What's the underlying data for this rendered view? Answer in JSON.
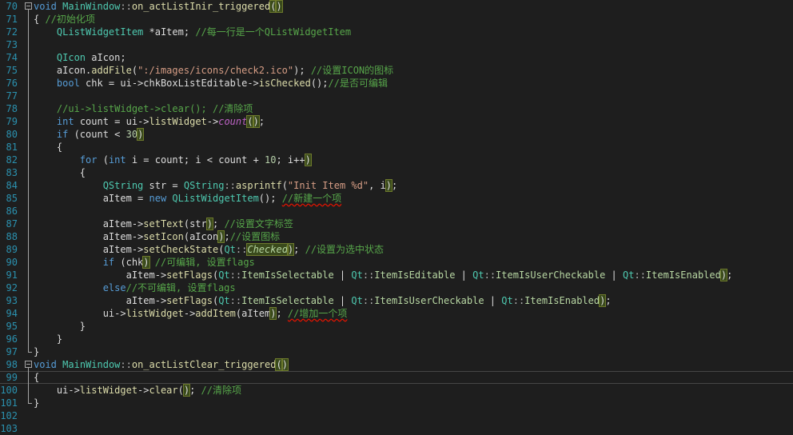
{
  "editor": {
    "lines": [
      {
        "n": "70",
        "fold": true,
        "segs": [
          [
            "kw",
            "void"
          ],
          [
            "pl",
            " "
          ],
          [
            "ty",
            "MainWindow"
          ],
          [
            "op",
            "::"
          ],
          [
            "fn",
            "on_actListInir_triggered"
          ],
          [
            "pm",
            "("
          ],
          [
            "pm",
            ")"
          ]
        ]
      },
      {
        "n": "71",
        "segs": [
          [
            "pl",
            "{ "
          ],
          [
            "cm",
            "//初始化项"
          ]
        ]
      },
      {
        "n": "72",
        "segs": [
          [
            "pl",
            "    "
          ],
          [
            "ty",
            "QListWidgetItem"
          ],
          [
            "pl",
            " *aItem; "
          ],
          [
            "cm",
            "//每一行是一个QListWidgetItem"
          ]
        ]
      },
      {
        "n": "73",
        "segs": []
      },
      {
        "n": "74",
        "segs": [
          [
            "pl",
            "    "
          ],
          [
            "ty",
            "QIcon"
          ],
          [
            "pl",
            " aIcon;"
          ]
        ]
      },
      {
        "n": "75",
        "segs": [
          [
            "pl",
            "    aIcon."
          ],
          [
            "fn",
            "addFile"
          ],
          [
            "pl",
            "("
          ],
          [
            "st",
            "\":/images/icons/check2.ico\""
          ],
          [
            "pl",
            "); "
          ],
          [
            "cm",
            "//设置ICON的图标"
          ]
        ]
      },
      {
        "n": "76",
        "segs": [
          [
            "pl",
            "    "
          ],
          [
            "kw",
            "bool"
          ],
          [
            "pl",
            " chk = ui->chkBoxListEditable->"
          ],
          [
            "fn",
            "isChecked"
          ],
          [
            "pl",
            "();"
          ],
          [
            "cm",
            "//是否可编辑"
          ]
        ]
      },
      {
        "n": "77",
        "segs": []
      },
      {
        "n": "78",
        "segs": [
          [
            "pl",
            "    "
          ],
          [
            "cm",
            "//ui->listWidget->clear(); //清除项"
          ]
        ]
      },
      {
        "n": "79",
        "segs": [
          [
            "pl",
            "    "
          ],
          [
            "kw",
            "int"
          ],
          [
            "pl",
            " count = ui->"
          ],
          [
            "fn",
            "listWidget"
          ],
          [
            "pl",
            "->"
          ],
          [
            "ac it",
            "count"
          ],
          [
            "pm",
            "("
          ],
          [
            "pm",
            ")"
          ],
          [
            "pl",
            ";"
          ]
        ]
      },
      {
        "n": "80",
        "segs": [
          [
            "pl",
            "    "
          ],
          [
            "kw",
            "if"
          ],
          [
            "pl",
            " (count < "
          ],
          [
            "nm",
            "30"
          ],
          [
            "pm",
            ")"
          ]
        ]
      },
      {
        "n": "81",
        "segs": [
          [
            "pl",
            "    {"
          ]
        ]
      },
      {
        "n": "82",
        "segs": [
          [
            "pl",
            "        "
          ],
          [
            "kw",
            "for"
          ],
          [
            "pl",
            " ("
          ],
          [
            "kw",
            "int"
          ],
          [
            "pl",
            " i = count; i < count + "
          ],
          [
            "nm",
            "10"
          ],
          [
            "pl",
            "; i++"
          ],
          [
            "pm",
            ")"
          ]
        ]
      },
      {
        "n": "83",
        "segs": [
          [
            "pl",
            "        {"
          ]
        ]
      },
      {
        "n": "84",
        "segs": [
          [
            "pl",
            "            "
          ],
          [
            "ty",
            "QString"
          ],
          [
            "pl",
            " str = "
          ],
          [
            "ty",
            "QString"
          ],
          [
            "op",
            "::"
          ],
          [
            "fn",
            "asprintf"
          ],
          [
            "pl",
            "("
          ],
          [
            "st",
            "\"Init Item %d\""
          ],
          [
            "pl",
            ", i"
          ],
          [
            "pm",
            ")"
          ],
          [
            "pl",
            ";"
          ]
        ]
      },
      {
        "n": "85",
        "segs": [
          [
            "pl",
            "            aItem = "
          ],
          [
            "kw",
            "new"
          ],
          [
            "pl",
            " "
          ],
          [
            "ty",
            "QListWidgetItem"
          ],
          [
            "pl",
            "(); "
          ],
          [
            "cm sq",
            "//新建一个项"
          ]
        ]
      },
      {
        "n": "86",
        "segs": []
      },
      {
        "n": "87",
        "segs": [
          [
            "pl",
            "            aItem->"
          ],
          [
            "fn",
            "setText"
          ],
          [
            "pl",
            "(str"
          ],
          [
            "pm",
            ")"
          ],
          [
            "pl",
            "; "
          ],
          [
            "cm",
            "//设置文字标签"
          ]
        ]
      },
      {
        "n": "88",
        "segs": [
          [
            "pl",
            "            aItem->"
          ],
          [
            "fn",
            "setIcon"
          ],
          [
            "pl",
            "(aIcon"
          ],
          [
            "pm",
            ")"
          ],
          [
            "pl",
            ";"
          ],
          [
            "cm",
            "//设置图标"
          ]
        ]
      },
      {
        "n": "89",
        "segs": [
          [
            "pl",
            "            aItem->"
          ],
          [
            "fn",
            "setCheckState"
          ],
          [
            "pl",
            "("
          ],
          [
            "ty",
            "Qt"
          ],
          [
            "op",
            "::"
          ],
          [
            "en it pm",
            "Checked"
          ],
          [
            "pm",
            ")"
          ],
          [
            "pl",
            "; "
          ],
          [
            "cm",
            "//设置为选中状态"
          ]
        ]
      },
      {
        "n": "90",
        "segs": [
          [
            "pl",
            "            "
          ],
          [
            "kw",
            "if"
          ],
          [
            "pl",
            " (chk"
          ],
          [
            "pm",
            ")"
          ],
          [
            "pl",
            " "
          ],
          [
            "cm",
            "//可编辑, 设置flags"
          ]
        ]
      },
      {
        "n": "91",
        "segs": [
          [
            "pl",
            "                aItem->"
          ],
          [
            "fn",
            "setFlags"
          ],
          [
            "pl",
            "("
          ],
          [
            "ty",
            "Qt"
          ],
          [
            "op",
            "::"
          ],
          [
            "en",
            "ItemIsSelectable"
          ],
          [
            "pl",
            " | "
          ],
          [
            "ty",
            "Qt"
          ],
          [
            "op",
            "::"
          ],
          [
            "en",
            "ItemIsEditable"
          ],
          [
            "pl",
            " | "
          ],
          [
            "ty",
            "Qt"
          ],
          [
            "op",
            "::"
          ],
          [
            "en",
            "ItemIsUserCheckable"
          ],
          [
            "pl",
            " | "
          ],
          [
            "ty",
            "Qt"
          ],
          [
            "op",
            "::"
          ],
          [
            "en",
            "ItemIsEnabled"
          ],
          [
            "pm",
            ")"
          ],
          [
            "pl",
            ";"
          ]
        ]
      },
      {
        "n": "92",
        "segs": [
          [
            "pl",
            "            "
          ],
          [
            "kw",
            "else"
          ],
          [
            "cm",
            "//不可编辑, 设置flags"
          ]
        ]
      },
      {
        "n": "93",
        "segs": [
          [
            "pl",
            "                aItem->"
          ],
          [
            "fn",
            "setFlags"
          ],
          [
            "pl",
            "("
          ],
          [
            "ty",
            "Qt"
          ],
          [
            "op",
            "::"
          ],
          [
            "en",
            "ItemIsSelectable"
          ],
          [
            "pl",
            " | "
          ],
          [
            "ty",
            "Qt"
          ],
          [
            "op",
            "::"
          ],
          [
            "en",
            "ItemIsUserCheckable"
          ],
          [
            "pl",
            " | "
          ],
          [
            "ty",
            "Qt"
          ],
          [
            "op",
            "::"
          ],
          [
            "en",
            "ItemIsEnabled"
          ],
          [
            "pm",
            ")"
          ],
          [
            "pl",
            ";"
          ]
        ]
      },
      {
        "n": "94",
        "segs": [
          [
            "pl",
            "            ui->"
          ],
          [
            "fn",
            "listWidget"
          ],
          [
            "pl",
            "->"
          ],
          [
            "fn",
            "addItem"
          ],
          [
            "pl",
            "(aItem"
          ],
          [
            "pm",
            ")"
          ],
          [
            "pl",
            "; "
          ],
          [
            "cm sq",
            "//增加一个项"
          ]
        ]
      },
      {
        "n": "95",
        "segs": [
          [
            "pl",
            "        }"
          ]
        ]
      },
      {
        "n": "96",
        "segs": [
          [
            "pl",
            "    }"
          ]
        ]
      },
      {
        "n": "97",
        "segs": [
          [
            "pl",
            "}"
          ]
        ]
      },
      {
        "n": "98",
        "fold": true,
        "segs": [
          [
            "kw",
            "void"
          ],
          [
            "pl",
            " "
          ],
          [
            "ty",
            "MainWindow"
          ],
          [
            "op",
            "::"
          ],
          [
            "fn",
            "on_actListClear_triggered"
          ],
          [
            "pm",
            "("
          ],
          [
            "pm",
            ")"
          ]
        ]
      },
      {
        "n": "99",
        "current": true,
        "segs": [
          [
            "pl",
            "{"
          ]
        ]
      },
      {
        "n": "100",
        "segs": [
          [
            "pl",
            "    ui->"
          ],
          [
            "fn",
            "listWidget"
          ],
          [
            "pl",
            "->"
          ],
          [
            "fn",
            "clear"
          ],
          [
            "pl",
            "("
          ],
          [
            "pm",
            ")"
          ],
          [
            "pl",
            "; "
          ],
          [
            "cm",
            "//清除项"
          ]
        ]
      },
      {
        "n": "101",
        "segs": [
          [
            "pl",
            "}"
          ]
        ]
      },
      {
        "n": "102",
        "segs": []
      },
      {
        "n": "103",
        "segs": []
      }
    ]
  }
}
